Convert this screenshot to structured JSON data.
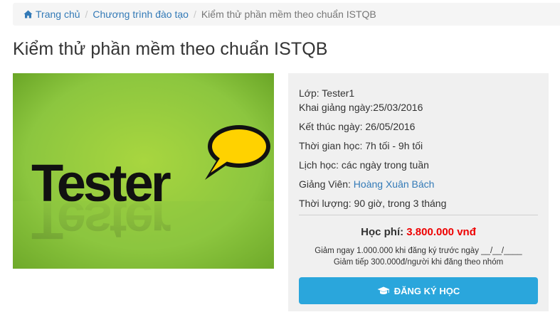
{
  "breadcrumb": {
    "home": "Trang chủ",
    "programs": "Chương trình đào tạo",
    "current": "Kiểm thử phần mềm theo chuẩn ISTQB",
    "separator": "/"
  },
  "page_title": "Kiểm thử phần mềm theo chuẩn ISTQB",
  "image": {
    "word": "Tester",
    "background_color": "#8cc63f",
    "bubble_color": "#ffd200"
  },
  "course": {
    "class": "Lớp: Tester1",
    "start": "Khai giảng ngày:25/03/2016",
    "end": "Kết thúc ngày: 26/05/2016",
    "time": "Thời gian học: 7h tối - 9h tối",
    "schedule": "Lịch học: các ngày trong tuần",
    "instructor_label": "Giảng Viên: ",
    "instructor_name": "Hoàng Xuân Bách",
    "duration": "Thời lượng: 90 giờ, trong 3 tháng"
  },
  "fee": {
    "label": "Học phí: ",
    "price": "3.800.000 vnđ"
  },
  "discounts": [
    "Giảm ngay 1.000.000 khi đăng ký trước ngày __/__/____",
    "Giảm tiếp 300.000đ/người khi đăng theo nhóm"
  ],
  "register_button": {
    "label": "ĐĂNG KÝ HỌC",
    "color": "#2aa6dc",
    "icon": "graduation-cap-icon"
  },
  "colors": {
    "link": "#337ab7",
    "price": "#ee0000",
    "panel_bg": "#f0f0f0"
  }
}
